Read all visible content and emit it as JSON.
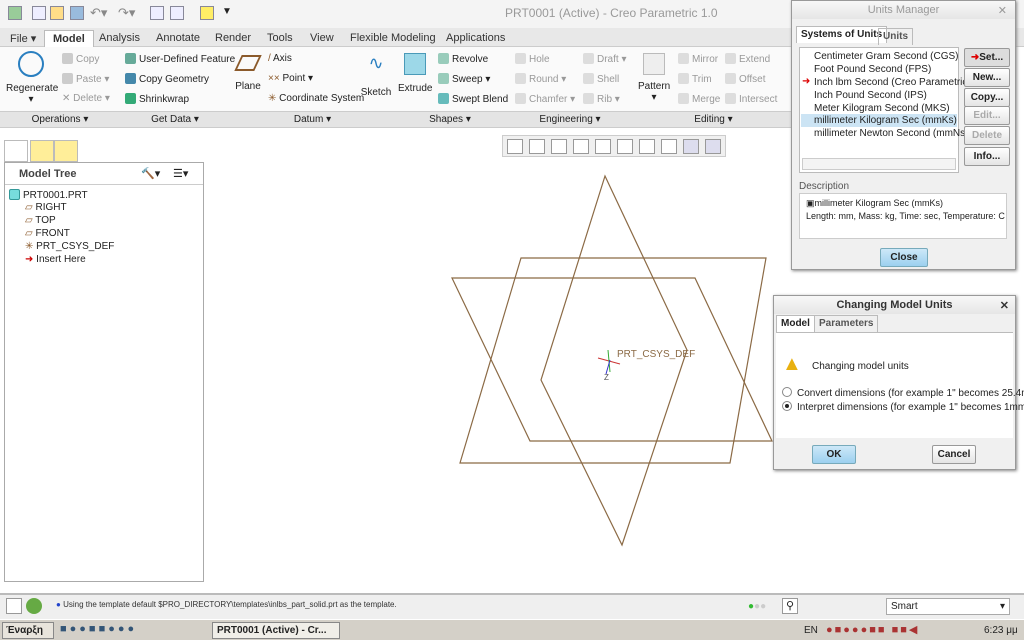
{
  "window": {
    "title": "PRT0001 (Active) - Creo Parametric 1.0"
  },
  "tabs": [
    "File",
    "Model",
    "Analysis",
    "Annotate",
    "Render",
    "Tools",
    "View",
    "Flexible Modeling",
    "Applications"
  ],
  "ribbon": {
    "regenerate": "Regenerate",
    "copy": "Copy",
    "paste": "Paste",
    "delete": "Delete",
    "udf": "User-Defined Feature",
    "copy_geometry": "Copy Geometry",
    "shrinkwrap": "Shrinkwrap",
    "plane": "Plane",
    "axis": "Axis",
    "point": "Point",
    "csys": "Coordinate System",
    "sketch": "Sketch",
    "extrude": "Extrude",
    "revolve": "Revolve",
    "sweep": "Sweep",
    "swept_blend": "Swept Blend",
    "hole": "Hole",
    "round": "Round",
    "chamfer": "Chamfer",
    "draft": "Draft",
    "shell": "Shell",
    "rib": "Rib",
    "pattern": "Pattern",
    "mirror": "Mirror",
    "trim": "Trim",
    "merge": "Merge",
    "extend": "Extend",
    "offset": "Offset",
    "intersect": "Intersect"
  },
  "groups": [
    "Operations",
    "Get Data",
    "Datum",
    "Shapes",
    "Engineering",
    "Editing"
  ],
  "model_tree": {
    "title": "Model Tree",
    "items": [
      "PRT0001.PRT",
      "RIGHT",
      "TOP",
      "FRONT",
      "PRT_CSYS_DEF",
      "Insert Here"
    ]
  },
  "graphics": {
    "csys_label": "PRT_CSYS_DEF",
    "axis_z": "Z",
    "line_color": "#8b6a45"
  },
  "units_manager": {
    "title": "Units Manager",
    "tabs": [
      "Systems of Units",
      "Units"
    ],
    "systems": [
      "Centimeter Gram Second (CGS)",
      "Foot Pound Second (FPS)",
      "Inch lbm Second (Creo Parametric De",
      "Inch Pound Second (IPS)",
      "Meter Kilogram Second (MKS)",
      "millimeter Kilogram Sec (mmKs)",
      "millimeter Newton Second (mmNs)"
    ],
    "selected": "millimeter Kilogram Sec (mmKs)",
    "active": "Inch lbm Second (Creo Parametric De",
    "buttons": [
      "Set...",
      "New...",
      "Copy...",
      "Edit...",
      "Delete",
      "Info..."
    ],
    "description_label": "Description",
    "description_name": "millimeter Kilogram Sec (mmKs)",
    "description_text": "Length: mm, Mass: kg, Time: sec, Temperature: C",
    "close": "Close"
  },
  "changing_units": {
    "title": "Changing Model Units",
    "tabs": [
      "Model",
      "Parameters"
    ],
    "message": "Changing model units",
    "options": [
      "Convert dimensions (for example 1\" becomes 25.4mm)",
      "Interpret dimensions (for example 1\" becomes 1mm)"
    ],
    "selected_option": 1,
    "ok": "OK",
    "cancel": "Cancel"
  },
  "status": {
    "message": "Using the template default $PRO_DIRECTORY\\templates\\inlbs_part_solid.prt as the template.",
    "filter": "Smart"
  },
  "taskbar": {
    "start": "Έναρξη",
    "task": "PRT0001 (Active) - Cr...",
    "lang": "EN",
    "clock": "6:23 μμ"
  }
}
